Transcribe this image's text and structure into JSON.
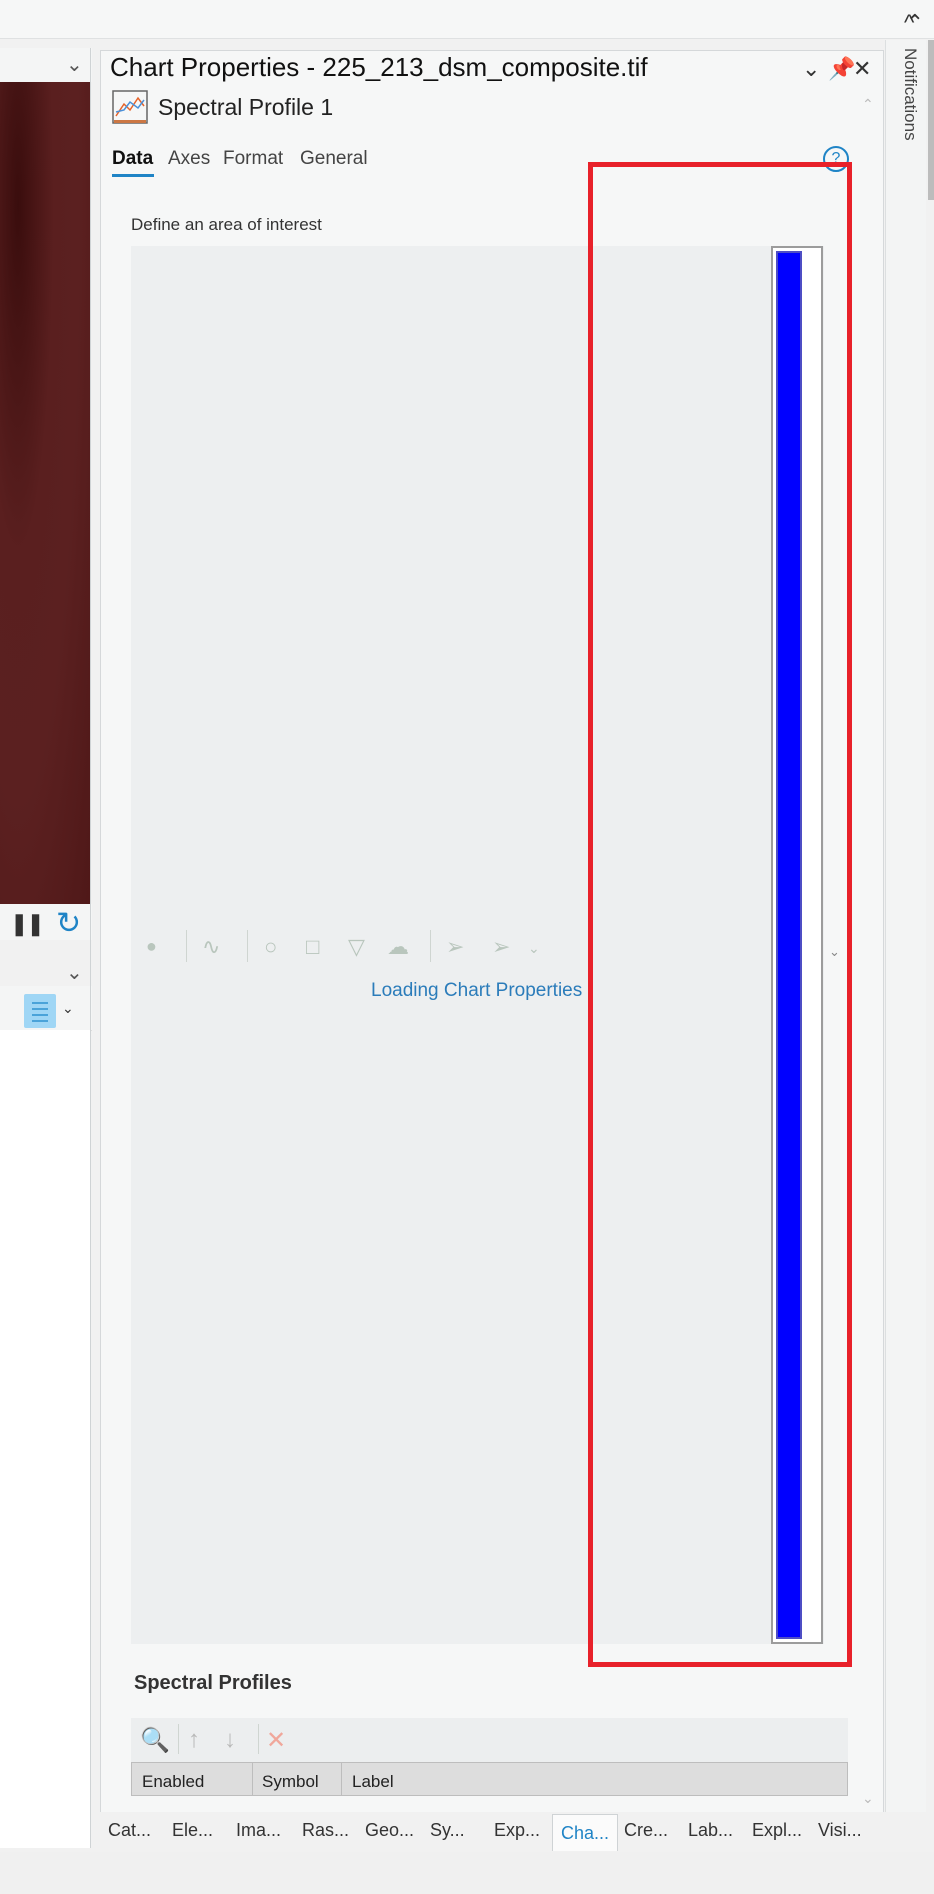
{
  "app": {
    "top_chevron": "^"
  },
  "pane": {
    "title": "Chart Properties - 225_213_dsm_composite.tif",
    "chart_name": "Spectral Profile 1",
    "tabs": [
      {
        "label": "Data",
        "active": true
      },
      {
        "label": "Axes"
      },
      {
        "label": "Format"
      },
      {
        "label": "General"
      }
    ],
    "help": "?",
    "aoi_label": "Define an area of interest",
    "loading_text": "Loading Chart Properties",
    "spectral_profiles": {
      "title": "Spectral Profiles",
      "columns": [
        "Enabled",
        "Symbol",
        "Label"
      ]
    }
  },
  "bottom_tabs": [
    {
      "label": "Cat..."
    },
    {
      "label": "Ele..."
    },
    {
      "label": "Ima..."
    },
    {
      "label": "Ras..."
    },
    {
      "label": "Geo..."
    },
    {
      "label": "Sy..."
    },
    {
      "label": "Exp..."
    },
    {
      "label": "Cha...",
      "active": true
    },
    {
      "label": "Cre..."
    },
    {
      "label": "Lab..."
    },
    {
      "label": "Expl..."
    },
    {
      "label": "Visi..."
    }
  ],
  "notifications": {
    "label": "Notifications"
  },
  "colors": {
    "accent": "#1f84c6",
    "highlight": "#e8212a",
    "scroll_thumb": "#0000ff",
    "map": "#5a1f1f"
  }
}
